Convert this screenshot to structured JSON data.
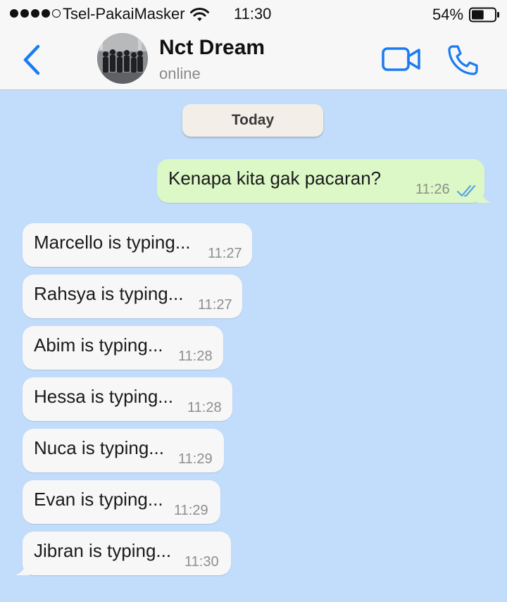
{
  "status_bar": {
    "carrier": "Tsel-PakaiMasker",
    "time": "11:30",
    "battery_percent": "54%",
    "battery_level": 0.54,
    "signal_bars_filled": 4,
    "signal_bars_total": 5,
    "icons": [
      "signal-dots",
      "wifi-icon",
      "battery-icon"
    ]
  },
  "header": {
    "contact_name": "Nct Dream",
    "contact_status": "online",
    "icons": [
      "back-chevron-icon",
      "group-avatar",
      "video-call-icon",
      "phone-icon"
    ],
    "accent_color": "#1a7cf0"
  },
  "chat": {
    "date_label": "Today",
    "background_color": "#c2dcfb",
    "outgoing": {
      "text": "Kenapa kita gak pacaran?",
      "time": "11:26",
      "status_icon": "double-check-read-icon",
      "bubble_color": "#dcf8c6"
    },
    "incoming_bubble_color": "#f7f7f7",
    "incoming": [
      {
        "text": "Marcello is typing...",
        "time": "11:27"
      },
      {
        "text": "Rahsya is typing...",
        "time": "11:27"
      },
      {
        "text": "Abim is typing...",
        "time": "11:28"
      },
      {
        "text": "Hessa is typing...",
        "time": "11:28"
      },
      {
        "text": "Nuca is typing...",
        "time": "11:29"
      },
      {
        "text": "Evan is typing...",
        "time": "11:29"
      },
      {
        "text": "Jibran is typing...",
        "time": "11:30"
      }
    ]
  }
}
